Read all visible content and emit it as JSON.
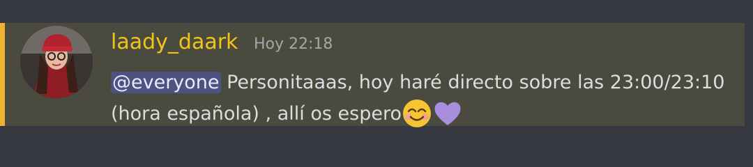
{
  "message": {
    "author": "laady_daark",
    "timestamp": "Hoy 22:18",
    "mention": "@everyone",
    "text_line1": " Personitaaas, hoy haré directo sobre las 23:00/23:10",
    "text_line2": "(hora española) , allí os espero",
    "emojis": [
      "smiling-face-icon",
      "purple-heart-icon"
    ],
    "colors": {
      "author": "#f0c419",
      "accent_bar": "#f0b232",
      "highlight_bg": "#4a4a3f",
      "mention_bg": "#4d5381"
    }
  }
}
